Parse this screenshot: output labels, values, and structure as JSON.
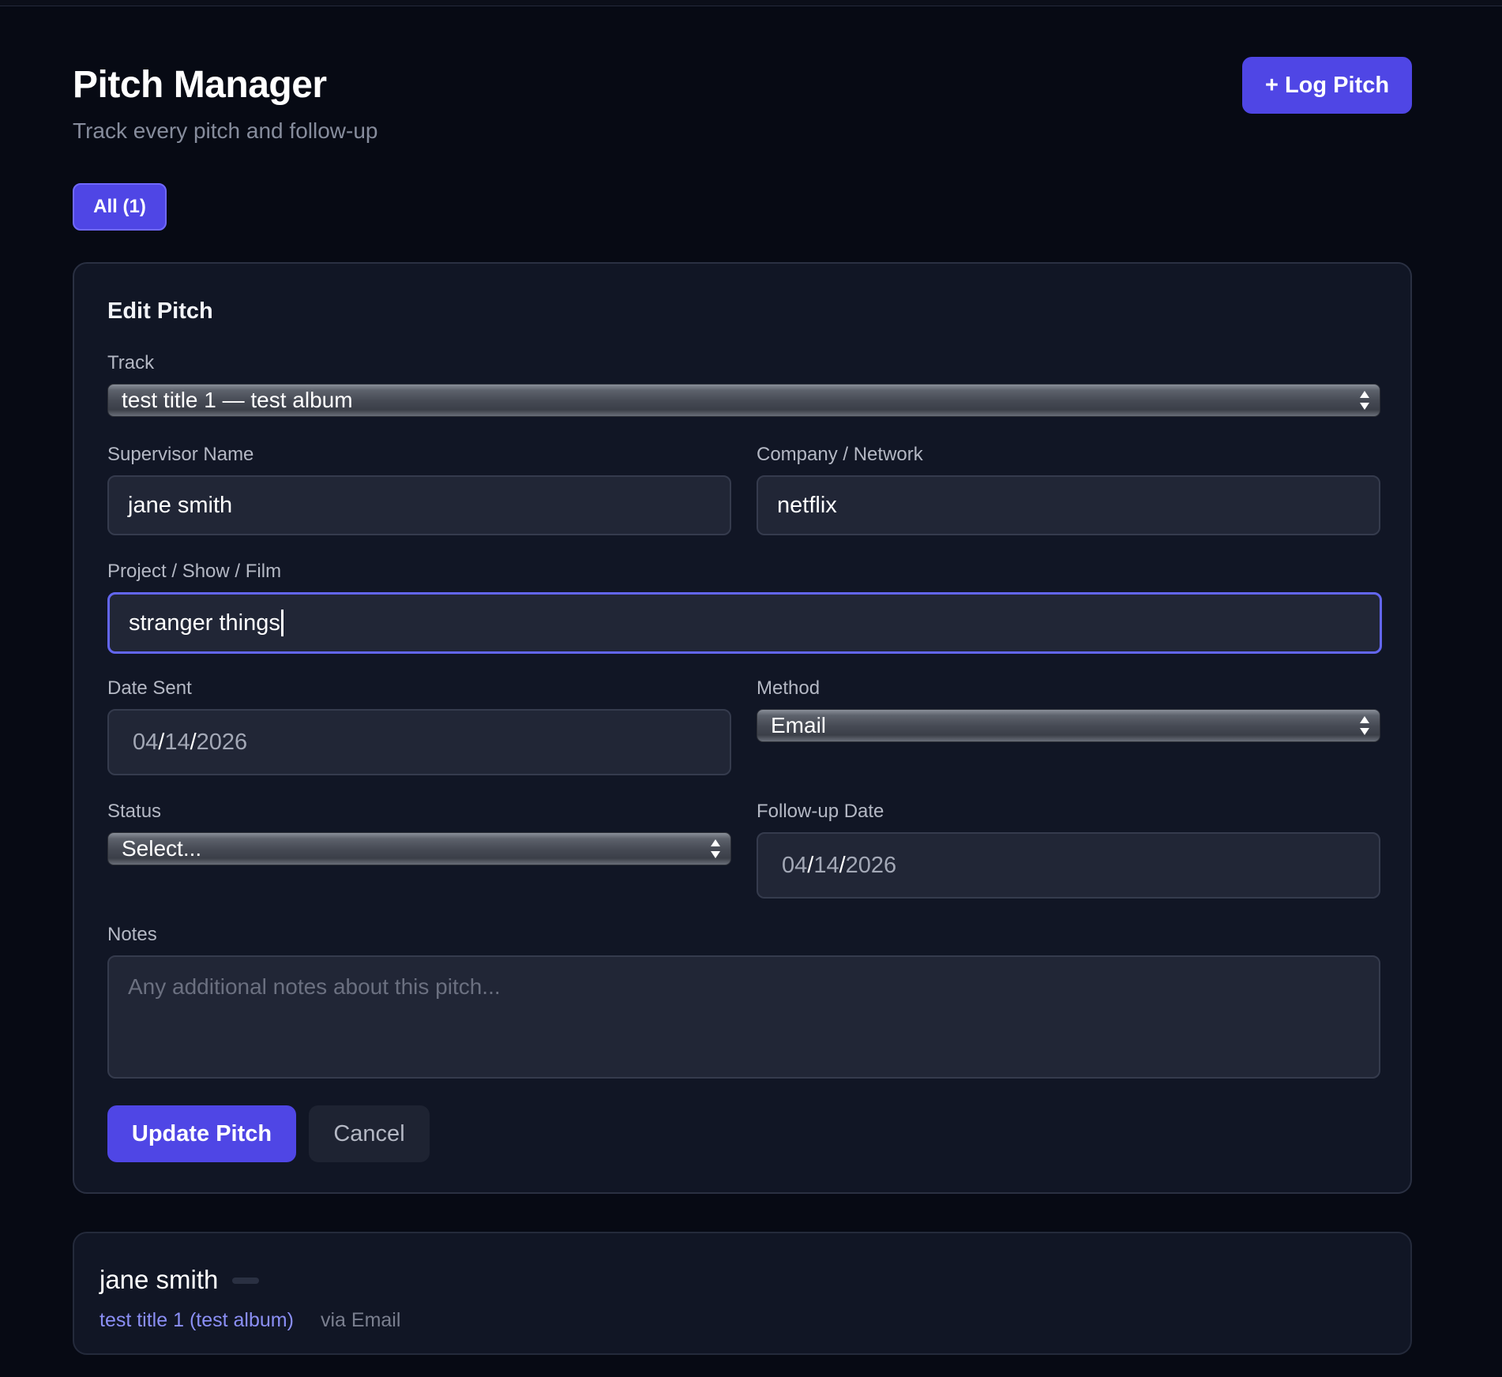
{
  "header": {
    "title": "Pitch Manager",
    "subtitle": "Track every pitch and follow-up",
    "log_button_label": "+ Log Pitch"
  },
  "filters": [
    {
      "label": "All (1)",
      "active": true
    }
  ],
  "form": {
    "title": "Edit Pitch",
    "track": {
      "label": "Track",
      "value": "test title 1 — test album"
    },
    "supervisor": {
      "label": "Supervisor Name",
      "value": "jane smith"
    },
    "company": {
      "label": "Company / Network",
      "value": "netflix"
    },
    "project": {
      "label": "Project / Show / Film",
      "value": "stranger things"
    },
    "date_sent": {
      "label": "Date Sent",
      "month": "04",
      "day": "14",
      "year": "2026",
      "sep": "/"
    },
    "method": {
      "label": "Method",
      "value": "Email"
    },
    "status": {
      "label": "Status",
      "value": "Select..."
    },
    "followup_date": {
      "label": "Follow-up Date",
      "month": "04",
      "day": "14",
      "year": "2026",
      "sep": "/"
    },
    "notes": {
      "label": "Notes",
      "placeholder": "Any additional notes about this pitch..."
    },
    "update_label": "Update Pitch",
    "cancel_label": "Cancel"
  },
  "pitches": [
    {
      "supervisor": "jane smith",
      "track": "test title 1 (test album)",
      "method": "via Email"
    }
  ],
  "colors": {
    "background": "#070a14",
    "card": "#111625",
    "accent": "#4f46e5",
    "focus_ring": "#6366f1",
    "link": "#8b8ff5"
  },
  "icons": [
    "select-arrows-icon"
  ]
}
